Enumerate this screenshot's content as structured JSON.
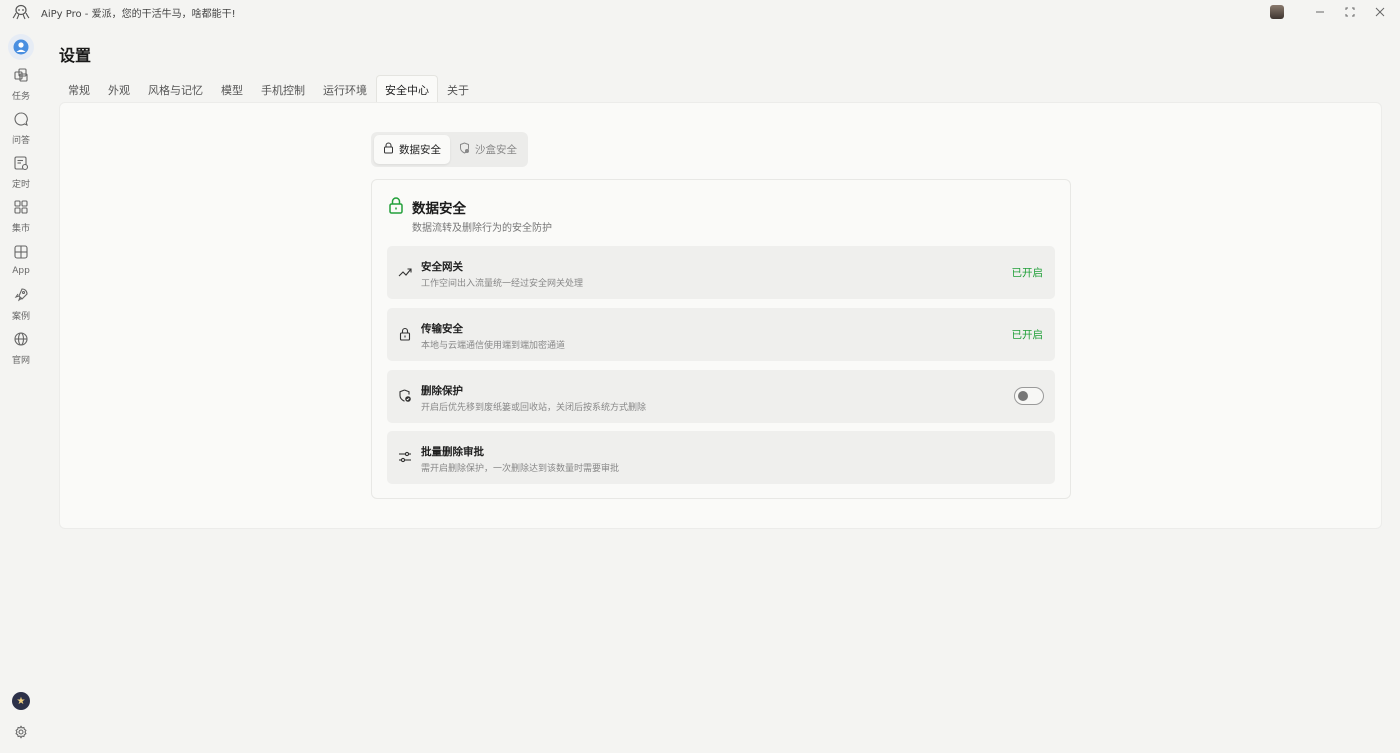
{
  "titlebar": {
    "app_name": "AiPy Pro  -  爱派，您的干活牛马，啥都能干!",
    "logo_icon": "octopus-logo-icon"
  },
  "sidebar": {
    "items": [
      {
        "label": "任务",
        "icon": "cubes-icon"
      },
      {
        "label": "问答",
        "icon": "chat-bubble-icon"
      },
      {
        "label": "定时",
        "icon": "schedule-icon"
      },
      {
        "label": "集市",
        "icon": "grid-shop-icon"
      },
      {
        "label": "App",
        "icon": "apps-grid-icon"
      },
      {
        "label": "案例",
        "icon": "rocket-icon"
      },
      {
        "label": "官网",
        "icon": "globe-icon"
      }
    ]
  },
  "page": {
    "title": "设置"
  },
  "tabs": [
    {
      "label": "常规"
    },
    {
      "label": "外观"
    },
    {
      "label": "风格与记忆"
    },
    {
      "label": "模型"
    },
    {
      "label": "手机控制"
    },
    {
      "label": "运行环境"
    },
    {
      "label": "安全中心",
      "active": true
    },
    {
      "label": "关于"
    }
  ],
  "segment": {
    "data_security": "数据安全",
    "sandbox_security": "沙盒安全"
  },
  "card": {
    "title": "数据安全",
    "desc": "数据流转及删除行为的安全防护",
    "rows": [
      {
        "title": "安全网关",
        "desc": "工作空间出入流量统一经过安全网关处理",
        "status": "已开启",
        "icon": "trending-up-icon"
      },
      {
        "title": "传输安全",
        "desc": "本地与云端通信使用端到端加密通道",
        "status": "已开启",
        "icon": "lock-icon"
      },
      {
        "title": "删除保护",
        "desc": "开启后优先移到废纸篓或回收站，关闭后按系统方式删除",
        "toggle_on": false,
        "icon": "shield-check-icon"
      },
      {
        "title": "批量删除审批",
        "desc": "需开启删除保护，一次删除达到该数量时需要审批",
        "icon": "sliders-icon"
      }
    ]
  },
  "colors": {
    "accent_green": "#22a03a",
    "background": "#f4f4f2"
  }
}
